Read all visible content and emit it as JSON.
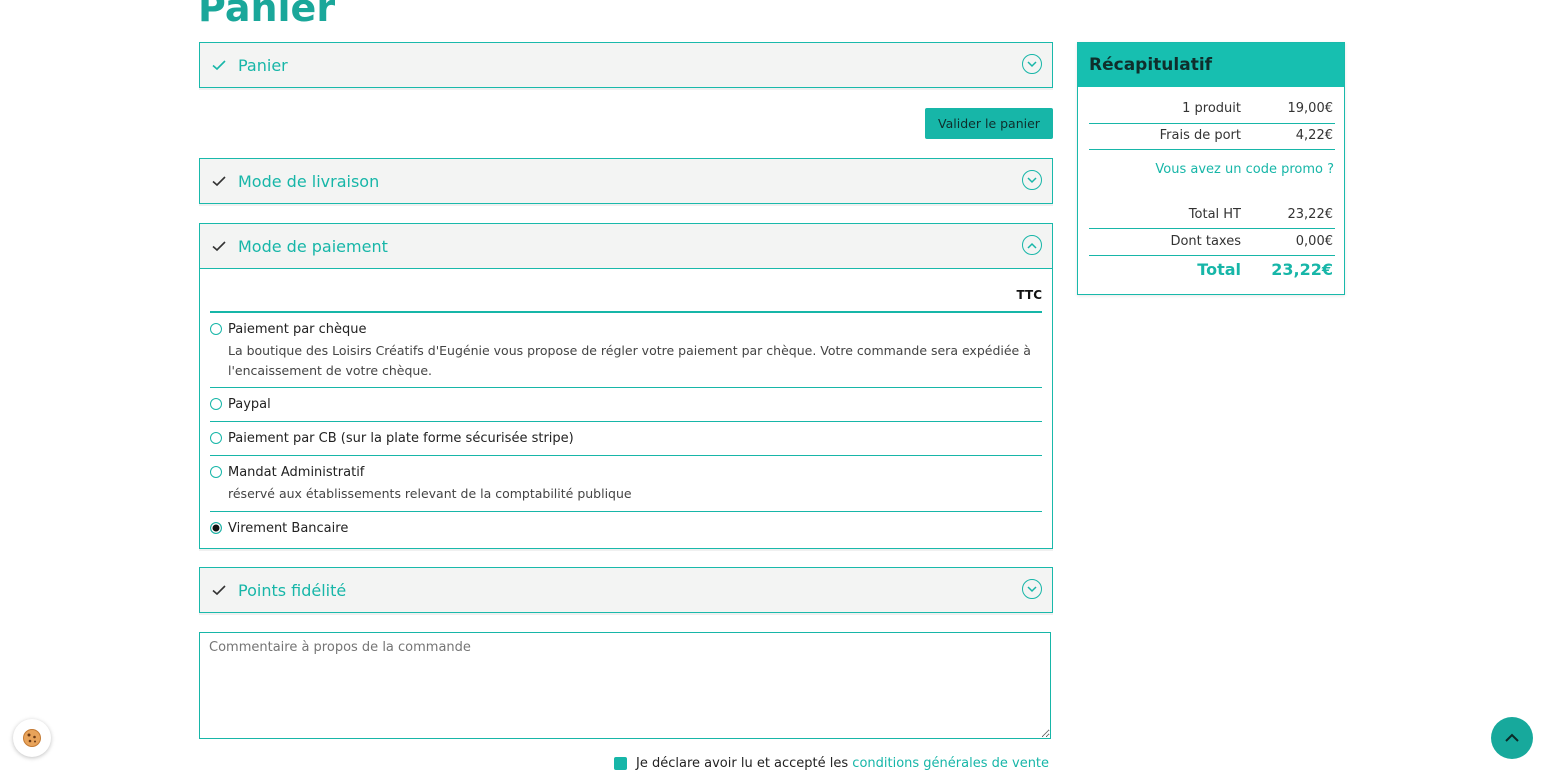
{
  "page": {
    "title": "Panier"
  },
  "sections": {
    "panier": {
      "title": "Panier"
    },
    "livraison": {
      "title": "Mode de livraison"
    },
    "paiement": {
      "title": "Mode de paiement"
    },
    "fidelite": {
      "title": "Points fidélité"
    }
  },
  "validate_button": "Valider le panier",
  "payment": {
    "ttc_label": "TTC",
    "options": [
      {
        "label": "Paiement par chèque",
        "description": "La boutique des Loisirs Créatifs d'Eugénie vous propose de régler votre paiement par chèque. Votre commande sera expédiée à l'encaissement de votre chèque.",
        "selected": false
      },
      {
        "label": "Paypal",
        "description": "",
        "selected": false
      },
      {
        "label": "Paiement par CB (sur la plate forme sécurisée stripe)",
        "description": "",
        "selected": false
      },
      {
        "label": "Mandat Administratif",
        "description": "réservé aux établissements relevant de la comptabilité publique",
        "selected": false
      },
      {
        "label": "Virement Bancaire",
        "description": "",
        "selected": true
      }
    ]
  },
  "comment": {
    "placeholder": "Commentaire à propos de la commande"
  },
  "summary": {
    "title": "Récapitulatif",
    "products_label": "1 produit",
    "products_value": "19,00€",
    "shipping_label": "Frais de port",
    "shipping_value": "4,22€",
    "promo_link": "Vous avez un code promo ?",
    "total_ht_label": "Total HT",
    "total_ht_value": "23,22€",
    "taxes_label": "Dont taxes",
    "taxes_value": "0,00€",
    "total_label": "Total",
    "total_value": "23,22€"
  },
  "terms": {
    "text": "Je déclare avoir lu et accepté les ",
    "link": "conditions générales de vente"
  },
  "colors": {
    "accent": "#17b6a8",
    "panel_bg": "#f3f4f3"
  },
  "icons": [
    "check-icon",
    "chevron-down-icon",
    "chevron-up-icon",
    "cookie-icon",
    "arrow-up-icon"
  ]
}
